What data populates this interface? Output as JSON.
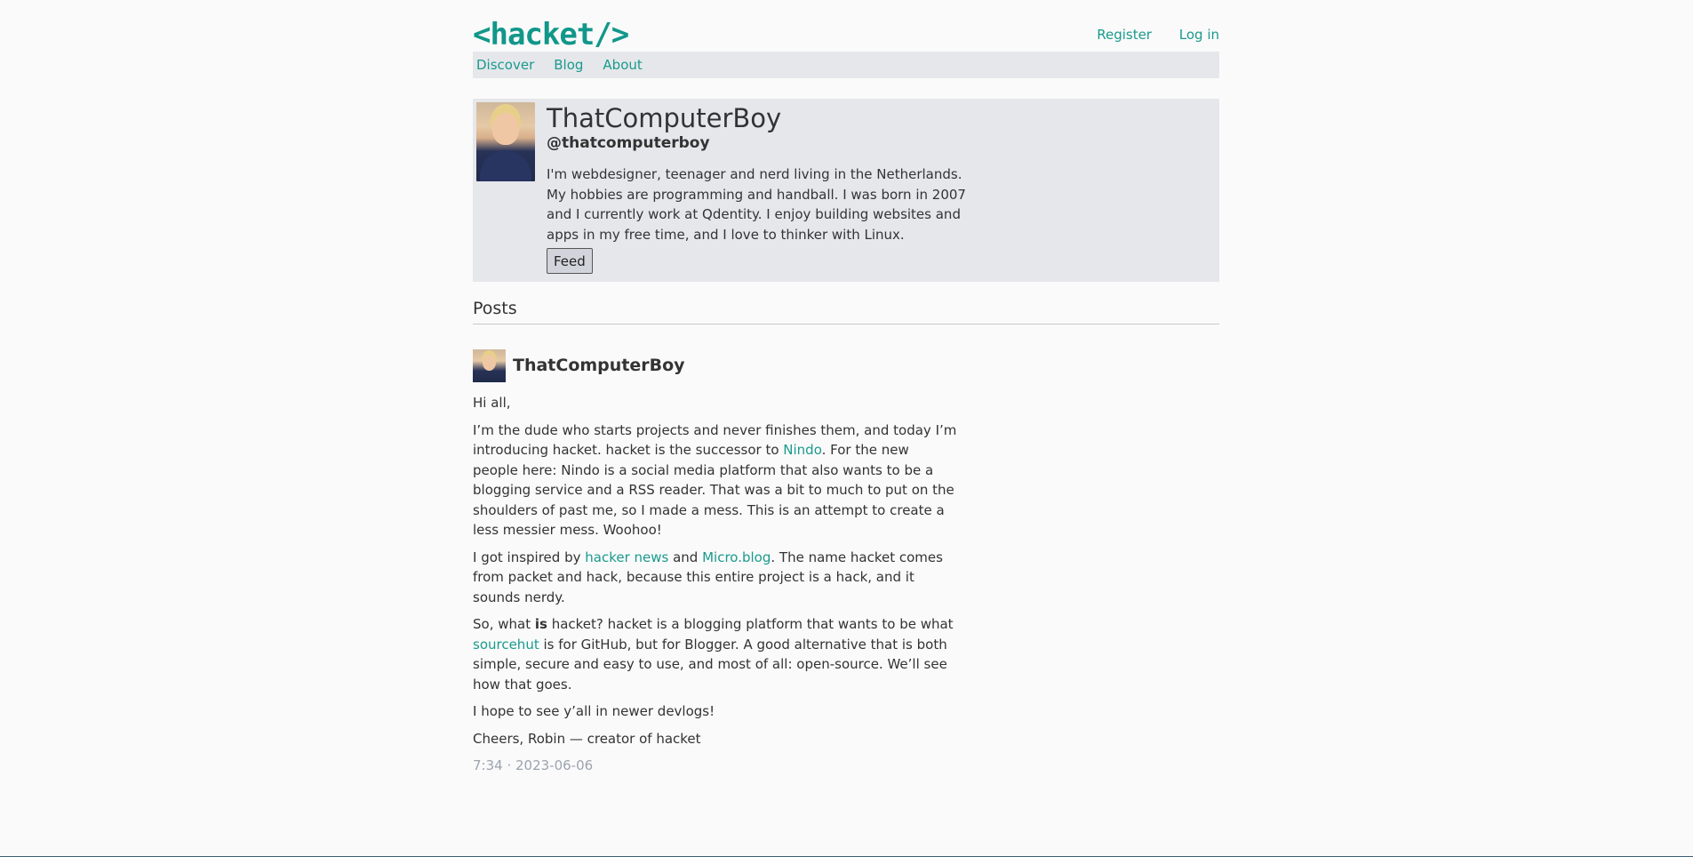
{
  "header": {
    "logo": "<hacket/>",
    "register_label": "Register",
    "login_label": "Log in"
  },
  "nav": {
    "items": [
      {
        "label": "Discover"
      },
      {
        "label": "Blog"
      },
      {
        "label": "About"
      }
    ]
  },
  "profile": {
    "display_name": "ThatComputerBoy",
    "handle": "@thatcomputerboy",
    "bio": "I'm webdesigner, teenager and nerd living in the Netherlands. My hobbies are programming and handball. I was born in 2007 and I currently work at Qdentity. I enjoy building websites and apps in my free time, and I love to thinker with Linux.",
    "feed_button": "Feed",
    "avatar_icon": "profile-photo"
  },
  "posts_section": {
    "title": "Posts"
  },
  "post": {
    "author": "ThatComputerBoy",
    "greeting": "Hi all,",
    "p1_a": "I’m the dude who starts projects and never finishes them, and today I’m introducing hacket. hacket is the successor to ",
    "p1_link": "Nindo",
    "p1_b": ". For the new people here: Nindo is a social media platform that also wants to be a blogging service and a RSS reader. That was a bit to much to put on the shoulders of past me, so I made a mess. This is an attempt to create a less messier mess. Woohoo!",
    "p2_a": "I got inspired by ",
    "p2_link1": "hacker news",
    "p2_b": " and ",
    "p2_link2": "Micro.blog",
    "p2_c": ". The name hacket comes from packet and hack, because this entire project is a hack, and it sounds nerdy.",
    "p3_a": "So, what ",
    "p3_bold": "is",
    "p3_b": " hacket? hacket is a blogging platform that wants to be what ",
    "p3_link": "sourcehut",
    "p3_c": " is for GitHub, but for Blogger. A good alternative that is both simple, secure and easy to use, and most of all: open-source. We’ll see how that goes.",
    "p4": "I hope to see y’all in newer devlogs!",
    "p5": "Cheers, Robin — creator of hacket",
    "meta": "7:34 · 2023-06-06"
  },
  "colors": {
    "accent": "#1a9a8d",
    "panel": "#e5e7eb",
    "background": "#fafafa"
  }
}
